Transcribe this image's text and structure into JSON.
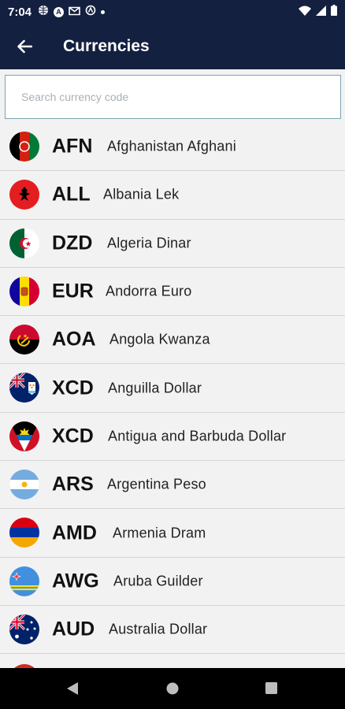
{
  "status_bar": {
    "time": "7:04",
    "icons": [
      "globe-icon",
      "a-icon",
      "gmail-icon",
      "vpn-icon",
      "notification-dot-icon"
    ],
    "right_icons": [
      "wifi-icon",
      "signal-icon",
      "battery-icon"
    ]
  },
  "app_bar": {
    "title": "Currencies",
    "back_icon": "arrow-left-icon"
  },
  "search": {
    "placeholder": "Search currency code",
    "value": ""
  },
  "currencies": [
    {
      "code": "AFN",
      "name": "Afghanistan Afghani",
      "flag": "afghanistan-flag"
    },
    {
      "code": "ALL",
      "name": "Albania Lek",
      "flag": "albania-flag"
    },
    {
      "code": "DZD",
      "name": "Algeria Dinar",
      "flag": "algeria-flag"
    },
    {
      "code": "EUR",
      "name": "Andorra Euro",
      "flag": "andorra-flag"
    },
    {
      "code": "AOA",
      "name": "Angola Kwanza",
      "flag": "angola-flag"
    },
    {
      "code": "XCD",
      "name": "Anguilla Dollar",
      "flag": "anguilla-flag"
    },
    {
      "code": "XCD",
      "name": "Antigua and Barbuda Dollar",
      "flag": "antigua-barbuda-flag"
    },
    {
      "code": "ARS",
      "name": "Argentina Peso",
      "flag": "argentina-flag"
    },
    {
      "code": "AMD",
      "name": "Armenia Dram",
      "flag": "armenia-flag"
    },
    {
      "code": "AWG",
      "name": "Aruba Guilder",
      "flag": "aruba-flag"
    },
    {
      "code": "AUD",
      "name": "Australia Dollar",
      "flag": "australia-flag"
    }
  ],
  "nav_bar": {
    "icons": [
      "back-triangle-icon",
      "home-circle-icon",
      "recents-square-icon"
    ]
  },
  "colors": {
    "app_bar": "#132040",
    "background": "#f2f2f2",
    "divider": "#d4d4d4",
    "search_border": "#7aa6b2"
  }
}
